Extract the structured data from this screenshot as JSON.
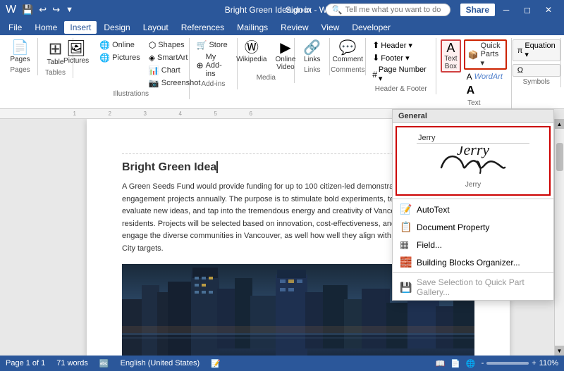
{
  "titleBar": {
    "title": "Bright Green Idea.docx - Word",
    "icons": [
      "save",
      "undo",
      "redo",
      "customize"
    ],
    "controls": [
      "minimize",
      "restore",
      "close"
    ]
  },
  "menuBar": {
    "items": [
      "File",
      "Home",
      "Insert",
      "Design",
      "Layout",
      "References",
      "Mailings",
      "Review",
      "View",
      "Developer"
    ]
  },
  "ribbon": {
    "activeTab": "Insert",
    "groups": [
      {
        "name": "Pages",
        "label": "Pages",
        "buttons": [
          {
            "icon": "📄",
            "label": "Pages"
          }
        ]
      },
      {
        "name": "Tables",
        "label": "Tables",
        "buttons": [
          {
            "icon": "⊞",
            "label": "Table"
          }
        ]
      },
      {
        "name": "Illustrations",
        "label": "Illustrations",
        "smallButtons": [
          "Pictures",
          "Online Pictures",
          "Shapes",
          "SmartArt",
          "Chart",
          "Screenshot"
        ]
      },
      {
        "name": "Add-ins",
        "label": "Add-ins",
        "buttons": [
          "Store",
          "My Add-ins"
        ]
      },
      {
        "name": "Media",
        "label": "Media",
        "buttons": [
          "Wikipedia",
          "Online Video"
        ]
      },
      {
        "name": "Links",
        "label": "Links",
        "buttons": [
          "Links"
        ]
      },
      {
        "name": "Comments",
        "label": "Comments",
        "buttons": [
          "Comment"
        ]
      },
      {
        "name": "Header & Footer",
        "label": "Header & Footer",
        "buttons": [
          "Header",
          "Footer",
          "Page Number"
        ]
      },
      {
        "name": "Text",
        "label": "Text",
        "buttons": [
          "Text Box",
          "Quick Parts",
          "WordArt",
          "Drop Cap"
        ]
      },
      {
        "name": "Symbols",
        "label": "Symbols",
        "buttons": [
          "Equation",
          "Symbol"
        ]
      }
    ],
    "tellMe": {
      "placeholder": "Tell me what you want to do"
    }
  },
  "document": {
    "title": "Bright Green Idea",
    "body": "A Green Seeds Fund would provide funding for up to 100 citizen-led demonstration or\nengagement projects annually. The purpose is to stimulate bold experiments, test and\nevaluate new ideas, and tap into the tremendous energy and creativity of Vancouver\nresidents. Projects will be selected based on innovation, cost-effectiveness, and ability to\nengage the diverse communities in Vancouver, as well how well they align with Greenest\nCity targets."
  },
  "quickPartsDropdown": {
    "header": "General",
    "signatureName": "Jerry",
    "signatureLabel": "Jerry",
    "items": [
      {
        "icon": "📝",
        "label": "AutoText",
        "disabled": false
      },
      {
        "icon": "📋",
        "label": "Document Property",
        "disabled": false
      },
      {
        "icon": "▦",
        "label": "Field...",
        "disabled": false
      },
      {
        "icon": "🧱",
        "label": "Building Blocks Organizer...",
        "disabled": false
      },
      {
        "icon": "💾",
        "label": "Save Selection to Quick Part Gallery...",
        "disabled": true
      }
    ]
  },
  "statusBar": {
    "page": "Page 1 of 1",
    "words": "71 words",
    "language": "English (United States)",
    "zoom": "110%"
  }
}
